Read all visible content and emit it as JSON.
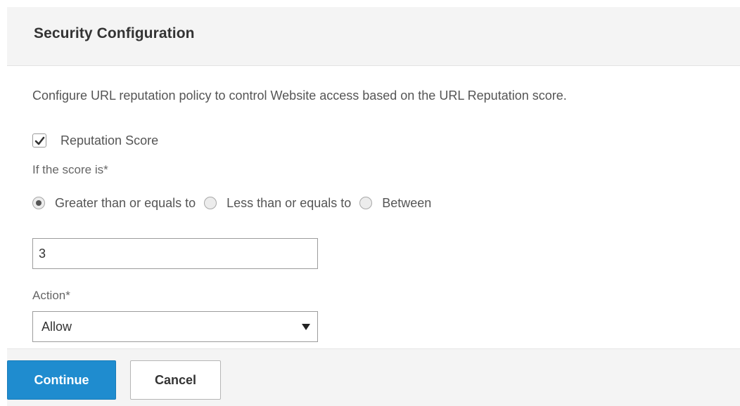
{
  "panel": {
    "title": "Security Configuration",
    "description": "Configure URL reputation policy to control Website access based on the URL Reputation score."
  },
  "reputation": {
    "checkbox_label": "Reputation Score",
    "checked": true
  },
  "score_condition": {
    "label": "If the score is*",
    "options": [
      {
        "label": "Greater than or equals to",
        "selected": true
      },
      {
        "label": "Less than or equals to",
        "selected": false
      },
      {
        "label": "Between",
        "selected": false
      }
    ]
  },
  "score_input": {
    "value": "3"
  },
  "action": {
    "label": "Action*",
    "selected": "Allow"
  },
  "footer": {
    "continue_label": "Continue",
    "cancel_label": "Cancel"
  },
  "colors": {
    "primary_button": "#1f8ccf",
    "header_background": "#f4f4f4"
  }
}
